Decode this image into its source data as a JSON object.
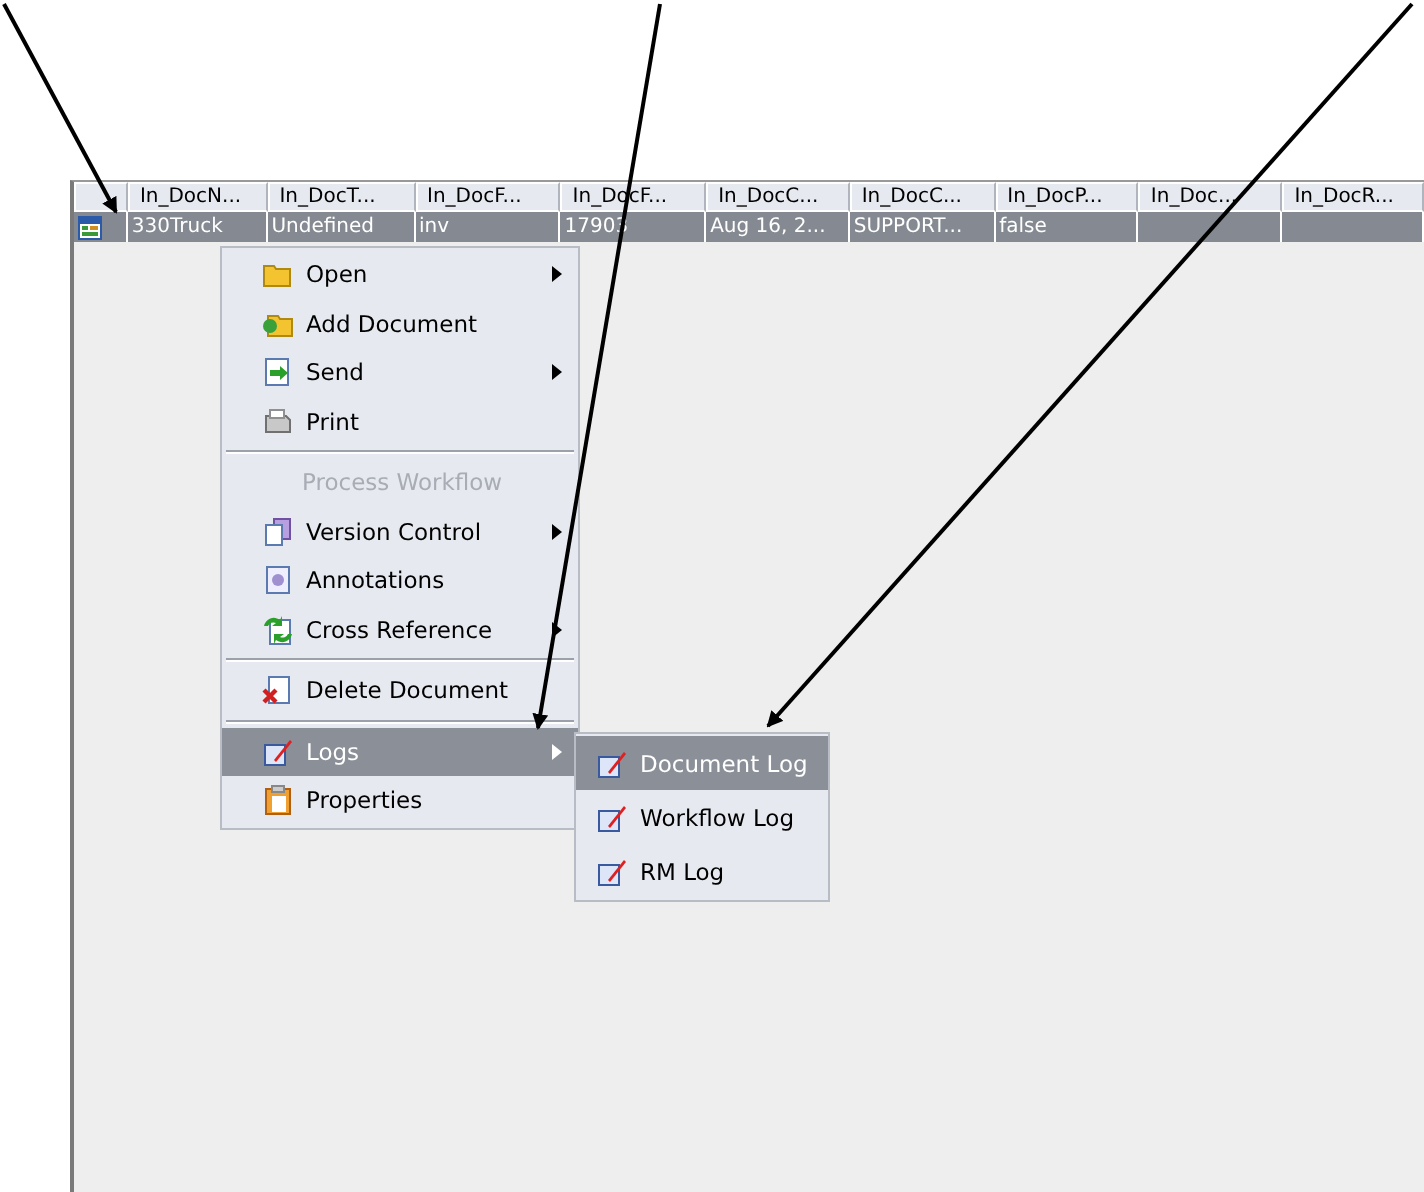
{
  "table": {
    "columns": [
      "",
      "In_DocN...",
      "In_DocT...",
      "In_DocF...",
      "In_DocF...",
      "In_DocC...",
      "In_DocC...",
      "In_DocP...",
      "In_Doc...",
      "In_DocR..."
    ],
    "rows": [
      {
        "selected": true,
        "cells": [
          "",
          "330Truck",
          "Undefined",
          "inv",
          "17903",
          "Aug 16, 2...",
          "SUPPORT...",
          "false",
          "",
          ""
        ]
      }
    ]
  },
  "context_menu": {
    "items": [
      {
        "kind": "item",
        "label": "Open",
        "submenu": true,
        "disabled": false,
        "selected": false
      },
      {
        "kind": "item",
        "label": "Add Document",
        "submenu": false,
        "disabled": false,
        "selected": false
      },
      {
        "kind": "item",
        "label": "Send",
        "submenu": true,
        "disabled": false,
        "selected": false
      },
      {
        "kind": "item",
        "label": "Print",
        "submenu": false,
        "disabled": false,
        "selected": false
      },
      {
        "kind": "separator"
      },
      {
        "kind": "item",
        "label": "Process Workflow",
        "submenu": false,
        "disabled": true,
        "selected": false
      },
      {
        "kind": "item",
        "label": "Version Control",
        "submenu": true,
        "disabled": false,
        "selected": false
      },
      {
        "kind": "item",
        "label": "Annotations",
        "submenu": false,
        "disabled": false,
        "selected": false
      },
      {
        "kind": "item",
        "label": "Cross Reference",
        "submenu": true,
        "disabled": false,
        "selected": false
      },
      {
        "kind": "separator"
      },
      {
        "kind": "item",
        "label": "Delete Document",
        "submenu": false,
        "disabled": false,
        "selected": false
      },
      {
        "kind": "separator"
      },
      {
        "kind": "item",
        "label": "Logs",
        "submenu": true,
        "disabled": false,
        "selected": true
      },
      {
        "kind": "item",
        "label": "Properties",
        "submenu": false,
        "disabled": false,
        "selected": false
      }
    ]
  },
  "submenu": {
    "items": [
      {
        "label": "Document Log",
        "selected": true
      },
      {
        "label": "Workflow Log",
        "selected": false
      },
      {
        "label": "RM Log",
        "selected": false
      }
    ]
  }
}
